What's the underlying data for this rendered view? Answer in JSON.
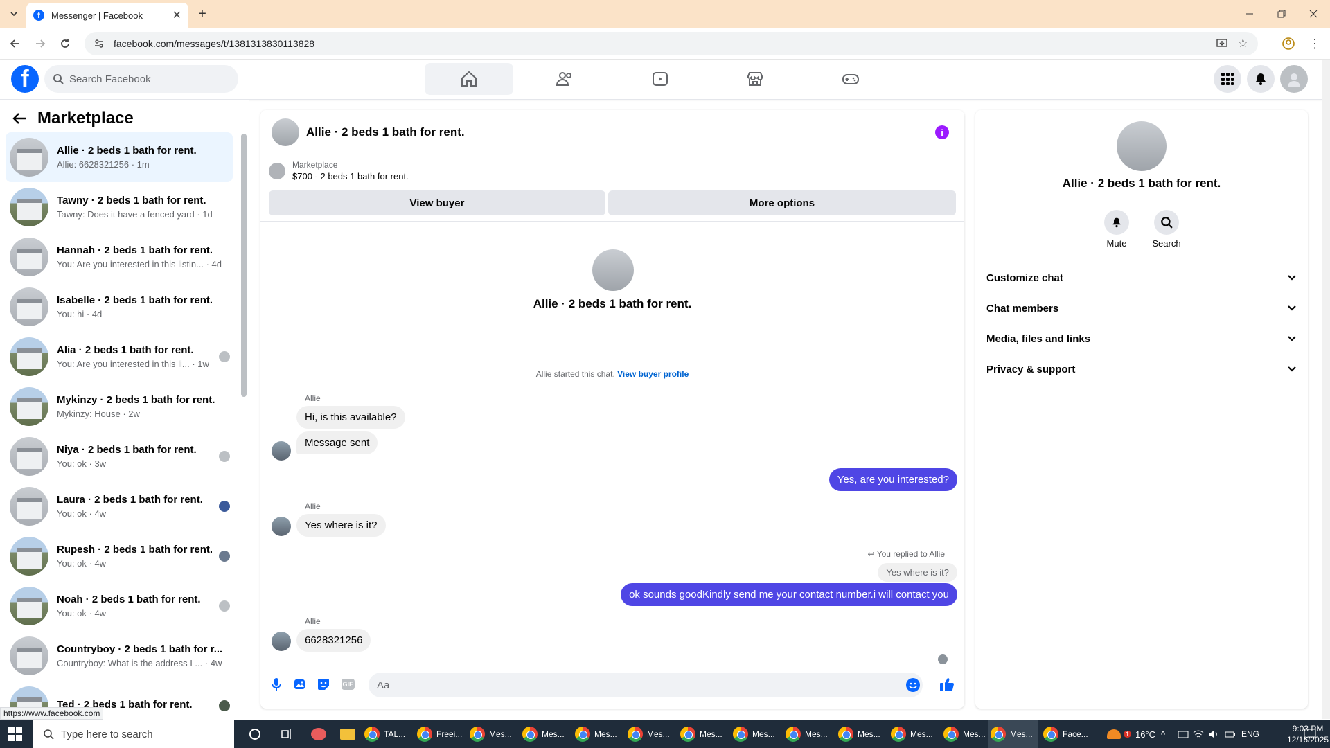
{
  "browser": {
    "tab_title": "Messenger | Facebook",
    "url": "facebook.com/messages/t/1381313830113828"
  },
  "fb": {
    "search_placeholder": "Search Facebook"
  },
  "left": {
    "title": "Marketplace",
    "conversations": [
      {
        "name": "Allie · 2 beds 1 bath for rent.",
        "preview": "Allie: 6628321256 · 1m"
      },
      {
        "name": "Tawny · 2 beds 1 bath for rent.",
        "preview": "Tawny: Does it have a fenced yard · 1d"
      },
      {
        "name": "Hannah · 2 beds 1 bath for rent.",
        "preview": "You: Are you interested in this listin... · 4d"
      },
      {
        "name": "Isabelle · 2 beds 1 bath for rent.",
        "preview": "You: hi · 4d"
      },
      {
        "name": "Alia · 2 beds 1 bath for rent.",
        "preview": "You: Are you interested in this li... · 1w"
      },
      {
        "name": "Mykinzy · 2 beds 1 bath for rent.",
        "preview": "Mykinzy: House · 2w"
      },
      {
        "name": "Niya · 2 beds 1 bath for rent.",
        "preview": "You: ok · 3w"
      },
      {
        "name": "Laura · 2 beds 1 bath for rent.",
        "preview": "You: ok · 4w"
      },
      {
        "name": "Rupesh · 2 beds 1 bath for rent.",
        "preview": "You: ok · 4w"
      },
      {
        "name": "Noah · 2 beds 1 bath for rent.",
        "preview": "You: ok · 4w"
      },
      {
        "name": "Countryboy · 2 beds 1 bath for r...",
        "preview": "Countryboy: What is the address I ... · 4w"
      },
      {
        "name": "Ted · 2 beds 1 bath for rent.",
        "preview": ""
      }
    ],
    "status_url": "https://www.facebook.com"
  },
  "chat": {
    "title": "Allie · 2 beds 1 bath for rent.",
    "listing_source": "Marketplace",
    "listing": "$700 - 2 beds 1 bath for rent.",
    "view_buyer": "View buyer",
    "more_options": "More options",
    "profile_name": "Allie · 2 beds 1 bath for rent.",
    "started_text": "Allie started this chat.",
    "view_buyer_profile": "View buyer profile",
    "sender1": "Allie",
    "msg1": "Hi, is this available?",
    "msg2": "Message sent",
    "out1": "Yes, are you interested?",
    "sender2": "Allie",
    "msg3": "Yes where is it?",
    "replied_label": "You replied to Allie",
    "quoted": "Yes where is it?",
    "out2": "ok sounds goodKindly send me your contact number.i will contact you",
    "sender3": "Allie",
    "msg4": "6628321256",
    "composer_placeholder": "Aa",
    "gif_label": "GIF"
  },
  "right": {
    "name": "Allie · 2 beds 1 bath for rent.",
    "mute": "Mute",
    "search": "Search",
    "sections": [
      "Customize chat",
      "Chat members",
      "Media, files and links",
      "Privacy & support"
    ]
  },
  "taskbar": {
    "search_placeholder": "Type here to search",
    "items": [
      "TAL...",
      "Freei...",
      "Mes...",
      "Mes...",
      "Mes...",
      "Mes...",
      "Mes...",
      "Mes...",
      "Mes...",
      "Mes...",
      "Mes...",
      "Mes...",
      "Mes...",
      "Face..."
    ],
    "temperature": "16°C",
    "language": "ENG",
    "time": "9:03 PM",
    "date": "12/16/2025",
    "notification_count": "1"
  }
}
